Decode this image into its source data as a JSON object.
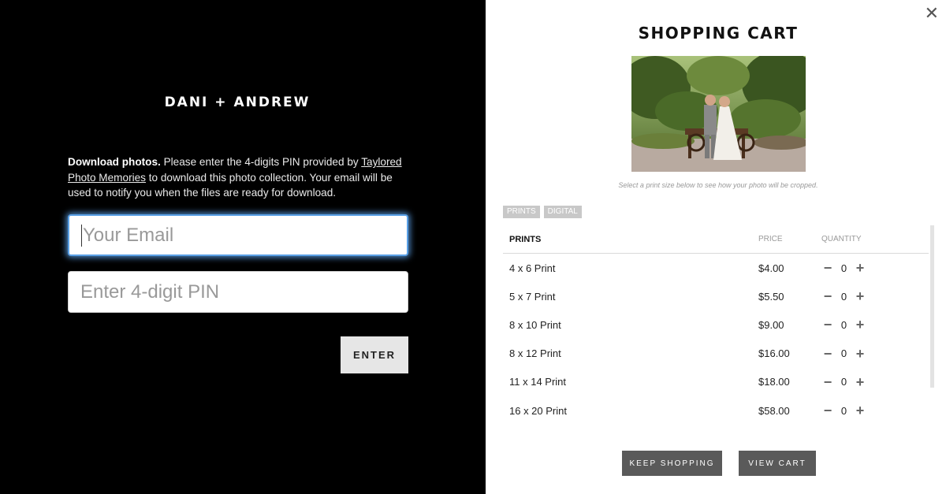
{
  "gallery": {
    "title": "DANI + ANDREW",
    "intro_bold": "Download photos.",
    "intro_pre": " Please enter the 4-digits PIN provided by ",
    "intro_link": "Taylored Photo Memories",
    "intro_post": " to download this photo collection. Your email will be used to notify you when the files are ready for download.",
    "email_placeholder": "Your Email",
    "pin_placeholder": "Enter 4-digit PIN",
    "enter_label": "ENTER"
  },
  "cart": {
    "close_icon": "close-icon",
    "title": "SHOPPING CART",
    "hint": "Select a print size below to see how your photo will be cropped.",
    "tabs": [
      "PRINTS",
      "DIGITAL"
    ],
    "headers": {
      "name": "PRINTS",
      "price": "PRICE",
      "quantity": "QUANTITY"
    },
    "items": [
      {
        "name": "4 x 6 Print",
        "price": "$4.00",
        "qty": "0"
      },
      {
        "name": "5 x 7 Print",
        "price": "$5.50",
        "qty": "0"
      },
      {
        "name": "8 x 10 Print",
        "price": "$9.00",
        "qty": "0"
      },
      {
        "name": "8 x 12 Print",
        "price": "$16.00",
        "qty": "0"
      },
      {
        "name": "11 x 14 Print",
        "price": "$18.00",
        "qty": "0"
      },
      {
        "name": "16 x 20 Print",
        "price": "$58.00",
        "qty": "0"
      }
    ],
    "keep_shopping": "KEEP SHOPPING",
    "view_cart": "VIEW CART"
  },
  "colors": {
    "left_bg": "#000000",
    "focus_glow": "#5aa0e6",
    "button_dark": "#5a5a5a",
    "tab_bg": "#c8c8c8"
  }
}
